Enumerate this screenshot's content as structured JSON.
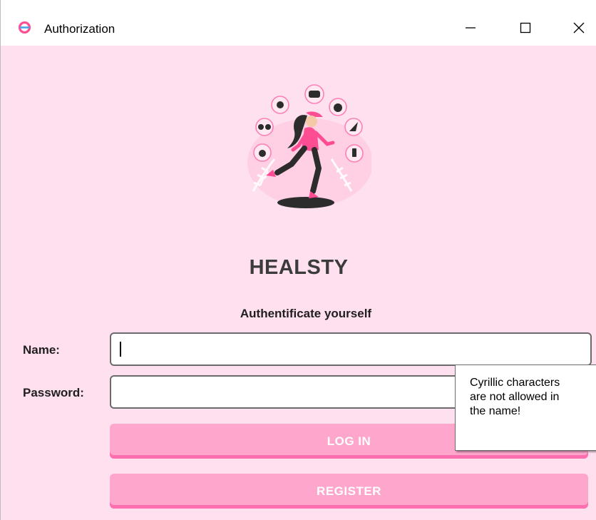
{
  "window": {
    "title": "Authorization",
    "app_icon": "app-logo-icon",
    "controls": [
      "minimize-icon",
      "maximize-icon",
      "close-icon"
    ]
  },
  "illustration": {
    "icon": "runner-healthy-lifestyle-illustration"
  },
  "brand": "HEALSTY",
  "subtitle": "Authentificate yourself",
  "form": {
    "name_label": "Name:",
    "name_value": "",
    "password_label": "Password:",
    "password_value": ""
  },
  "buttons": {
    "login": "LOG IN",
    "register": "REGISTER"
  },
  "tooltip": {
    "lines": [
      "Cyrillic characters",
      "are not allowed in",
      "the name!"
    ]
  },
  "colors": {
    "background": "#ffe0ef",
    "button": "#ffa6cd",
    "button_shadow": "#ff6fb0",
    "accent": "#ff4d94",
    "text_dark": "#3b3b3b"
  }
}
